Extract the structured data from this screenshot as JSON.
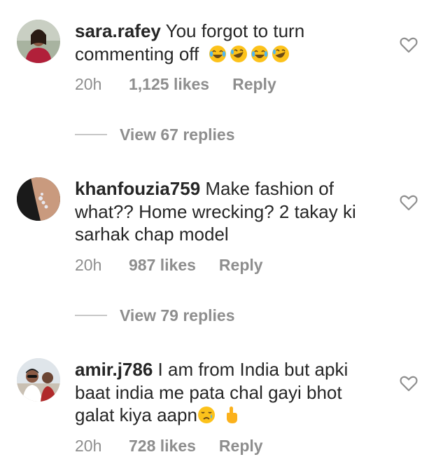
{
  "comments": [
    {
      "username": "sara.rafey",
      "text": " You forgot to turn commenting off",
      "emojis": [
        "laughing-tears-emoji",
        "rofl-emoji",
        "laughing-tears-emoji",
        "rofl-emoji"
      ],
      "time": "20h",
      "likes": "1,125 likes",
      "reply": "Reply",
      "view_replies": "View 67 replies"
    },
    {
      "username": "khanfouzia759",
      "text": " Make fashion of what?? Home wrecking? 2 takay ki sarhak chap model",
      "emojis": [],
      "time": "20h",
      "likes": "987 likes",
      "reply": "Reply",
      "view_replies": "View 79 replies"
    },
    {
      "username": "amir.j786",
      "text": " I am from India but apki baat india me pata chal gayi bhot galat kiya aapn",
      "emojis": [
        "crying-face-emoji",
        "pointing-up-emoji"
      ],
      "time": "20h",
      "likes": "728 likes",
      "reply": "Reply"
    }
  ],
  "colors": {
    "text": "#262626",
    "meta": "#8e8e8e",
    "divider": "#c7c7c7",
    "heart": "#8e8e8e",
    "emoji_yellow": "#fcc21b"
  }
}
